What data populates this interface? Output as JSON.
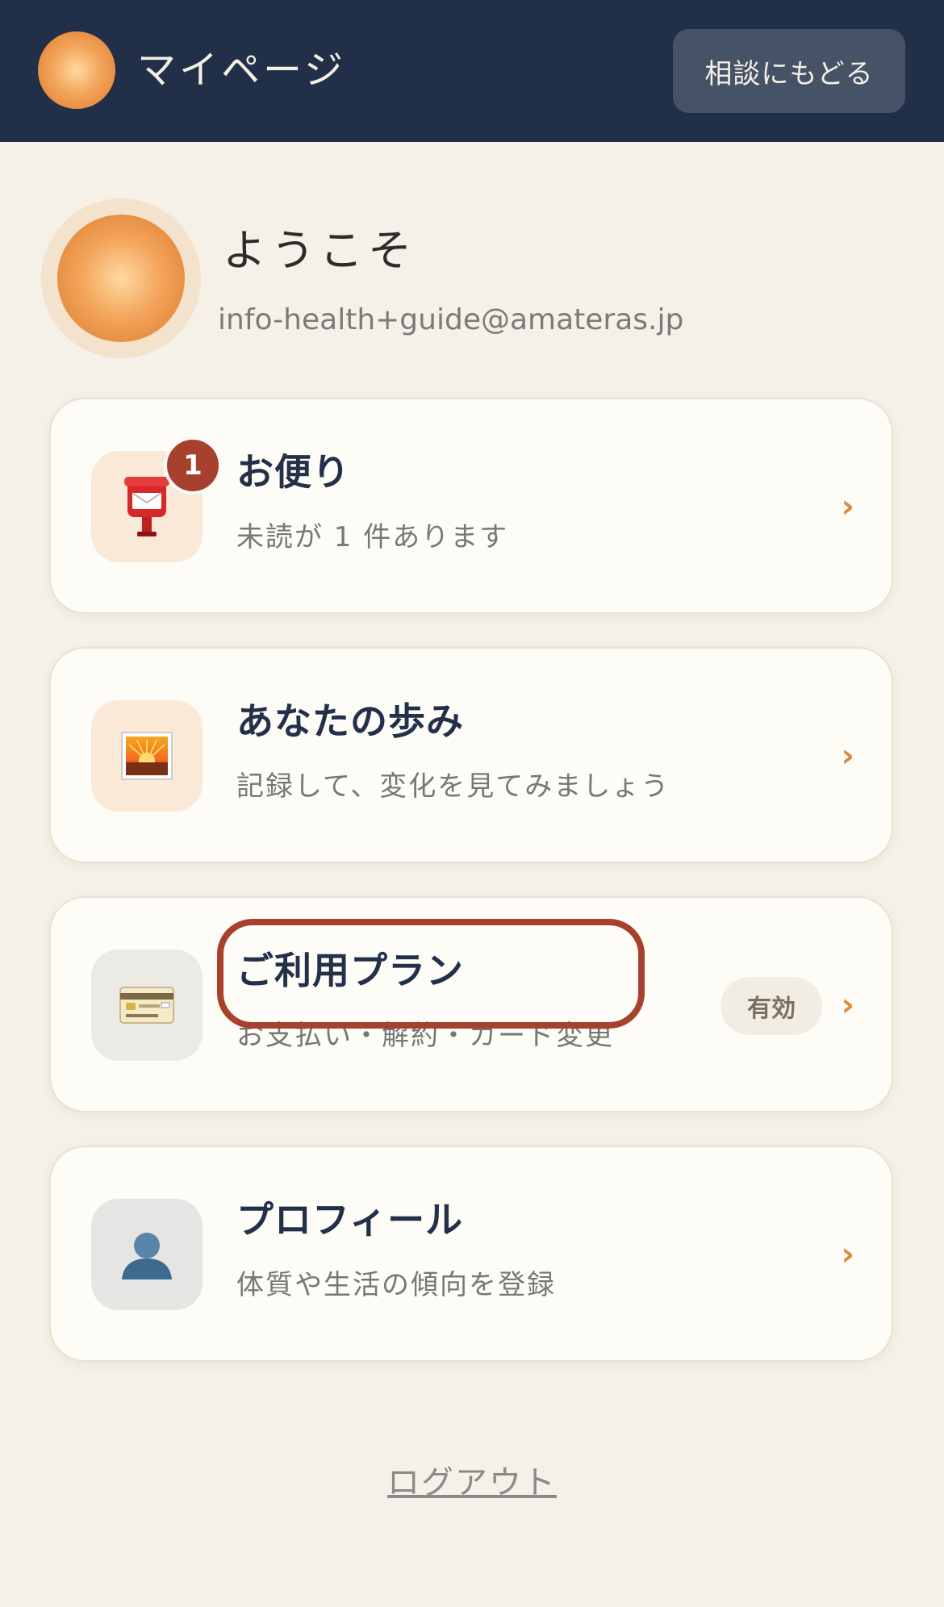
{
  "header": {
    "title": "マイページ",
    "back_button_label": "相談にもどる"
  },
  "profile": {
    "welcome": "ようこそ",
    "email": "info-health+guide@amateras.jp"
  },
  "cards": [
    {
      "title": "お便り",
      "subtitle": "未読が 1 件あります",
      "icon": "postbox-icon",
      "badge_count": "1",
      "chevron": "›"
    },
    {
      "title": "あなたの歩み",
      "subtitle": "記録して、変化を見てみましょう",
      "icon": "sunrise-picture-icon",
      "chevron": "›"
    },
    {
      "title": "ご利用プラン",
      "subtitle": "お支払い・解約・カード変更",
      "icon": "credit-card-icon",
      "status": "有効",
      "chevron": "›"
    },
    {
      "title": "プロフィール",
      "subtitle": "体質や生活の傾向を登録",
      "icon": "person-silhouette-icon",
      "chevron": "›"
    }
  ],
  "logout_label": "ログアウト",
  "colors": {
    "header_bg": "#213048",
    "page_bg": "#f5f1e8",
    "accent": "#dd8a3c",
    "badge": "#a8402e",
    "highlight": "#a8402e"
  }
}
